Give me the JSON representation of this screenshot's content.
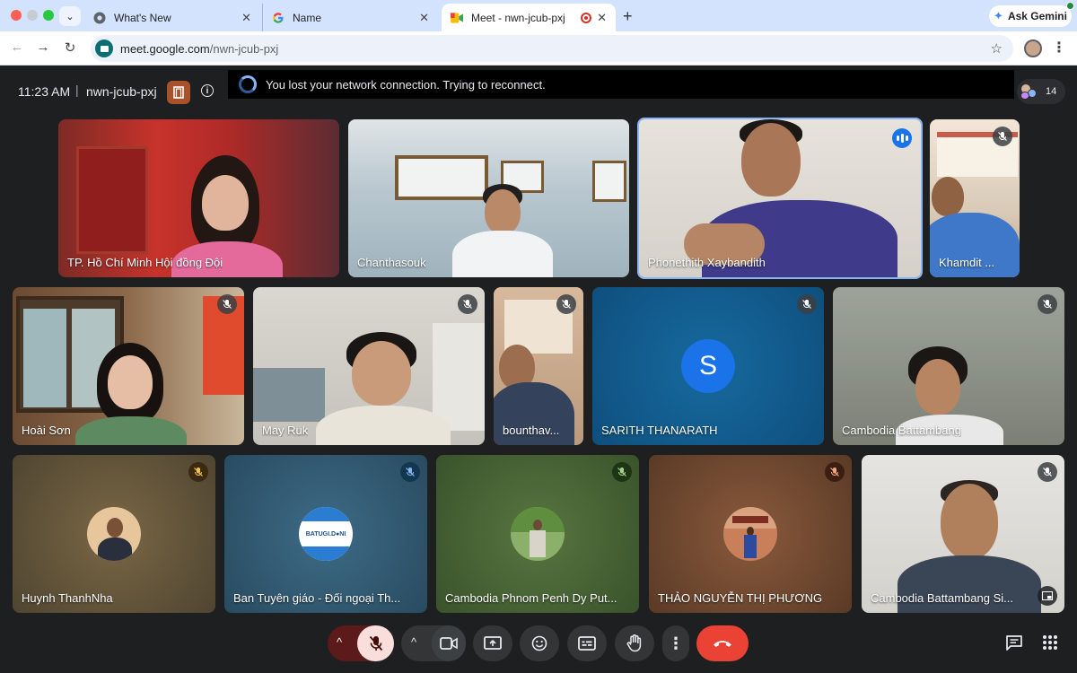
{
  "browser": {
    "tabs": [
      {
        "title": "What's New",
        "icon": "chrome-icon"
      },
      {
        "title": "Name",
        "icon": "google-icon"
      },
      {
        "title": "Meet - nwn-jcub-pxj",
        "icon": "meet-icon",
        "active": true,
        "recording": true
      }
    ],
    "url_host": "meet.google.com",
    "url_path": "/nwn-jcub-pxj",
    "ask_gemini": "Ask Gemini"
  },
  "meeting": {
    "time": "11:23 AM",
    "separator": "|",
    "code": "nwn-jcub-pxj",
    "banner": "You lost your network connection. Trying to reconnect.",
    "participant_count": "14"
  },
  "participants": [
    {
      "name": "TP. Hồ Chí Minh Hội đồng Đội",
      "muted": false
    },
    {
      "name": "Chanthasouk",
      "muted": false
    },
    {
      "name": "Phonethith Xaybandith",
      "muted": false,
      "speaking": true
    },
    {
      "name": "Khamdit ...",
      "muted": true
    },
    {
      "name": "Hoài Sơn",
      "muted": true
    },
    {
      "name": "May Ruk",
      "muted": true
    },
    {
      "name": "bounthav...",
      "muted": true
    },
    {
      "name": "SARITH THANARATH",
      "muted": true,
      "initial": "S"
    },
    {
      "name": "Cambodia Battambang",
      "muted": true
    },
    {
      "name": "Huynh ThanhNha",
      "muted": true
    },
    {
      "name": "Ban Tuyên giáo - Đối ngoại Th...",
      "muted": true,
      "avatar_text": "BATUGI.D●NI"
    },
    {
      "name": "Cambodia Phnom Penh Dy Put...",
      "muted": true
    },
    {
      "name": "THẢO NGUYỄN THỊ PHƯƠNG",
      "muted": true
    },
    {
      "name": "Cambodia Battambang Si...",
      "muted": true
    }
  ],
  "colors": {
    "background": "#1e1f20",
    "end_call": "#ea4335",
    "speaking_border": "#8ab4f8",
    "mic_off_bg": "#f9dedc",
    "sarith_avatar": "#1a73e8"
  }
}
